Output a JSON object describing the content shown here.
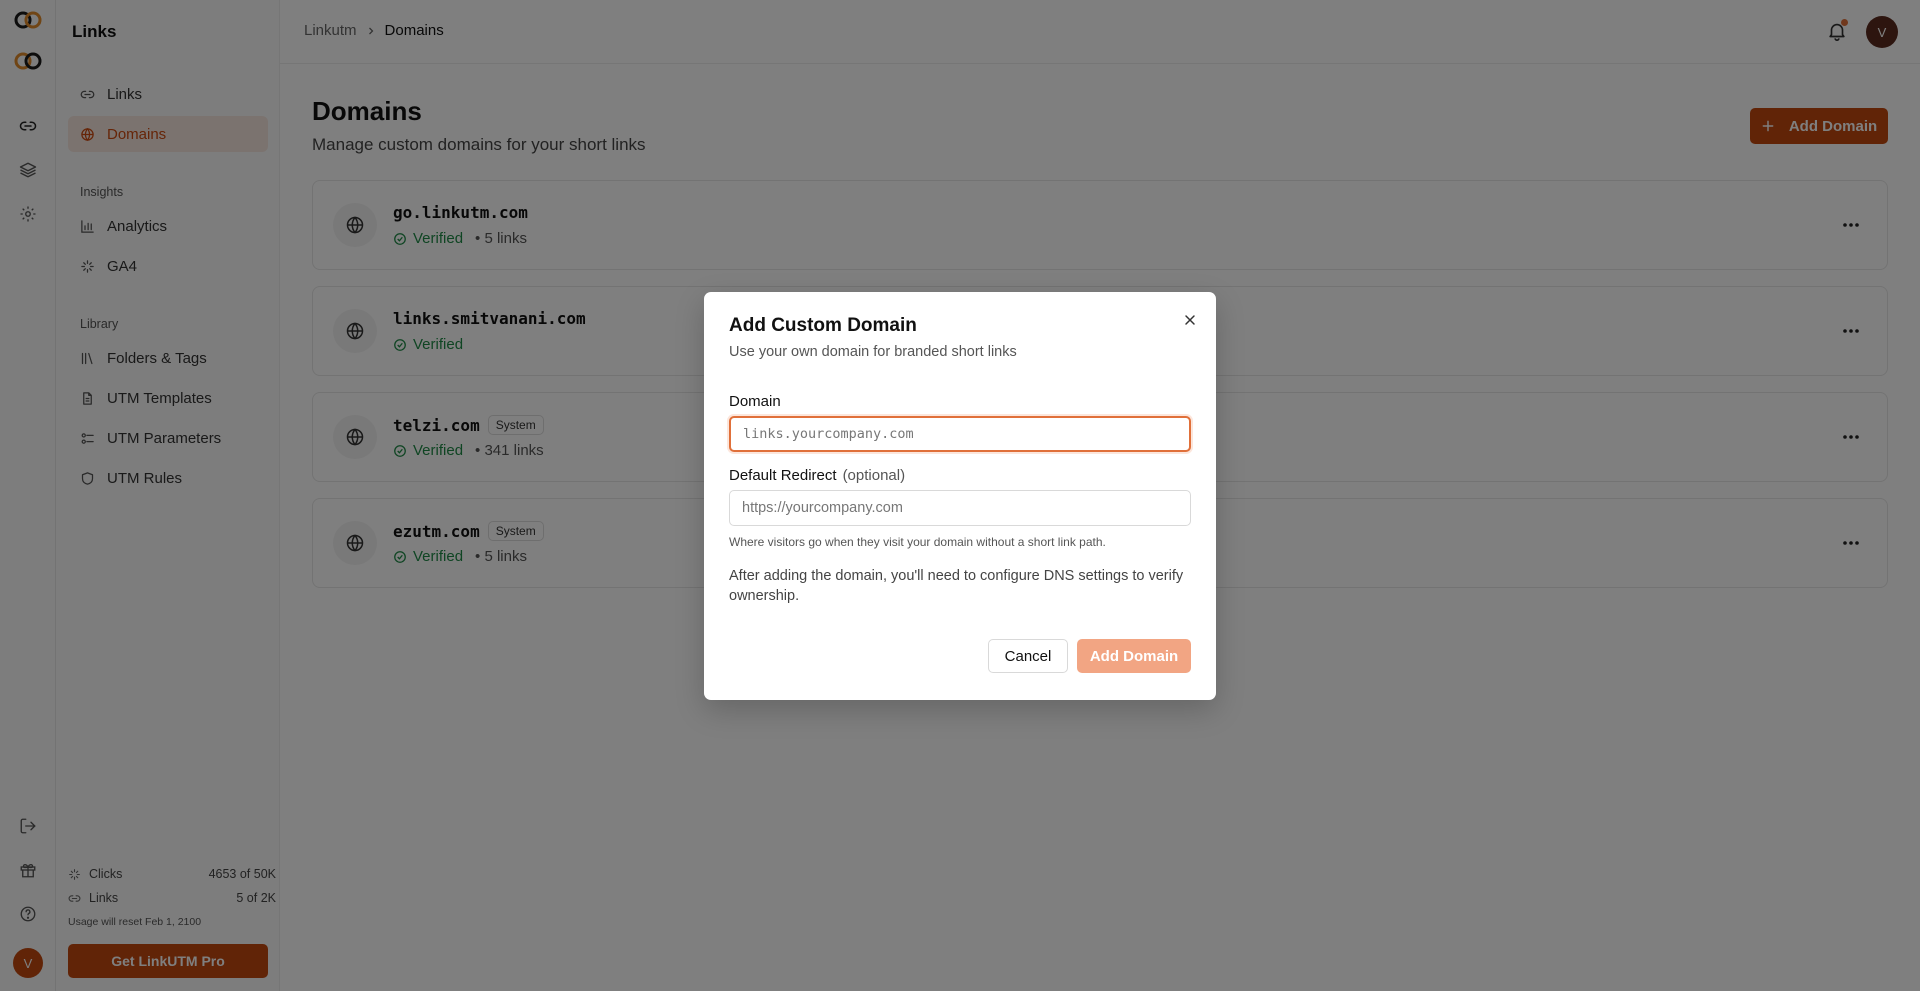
{
  "sidebar": {
    "title": "Links",
    "nav": [
      {
        "label": "Links",
        "icon": "link-icon",
        "active": false
      },
      {
        "label": "Domains",
        "icon": "globe-icon",
        "active": true
      }
    ],
    "insights_label": "Insights",
    "insights": [
      {
        "label": "Analytics",
        "icon": "bar-chart-icon"
      },
      {
        "label": "GA4",
        "icon": "sparkle-icon"
      }
    ],
    "library_label": "Library",
    "library": [
      {
        "label": "Folders & Tags",
        "icon": "library-icon"
      },
      {
        "label": "UTM Templates",
        "icon": "document-icon"
      },
      {
        "label": "UTM Parameters",
        "icon": "parameters-icon"
      },
      {
        "label": "UTM Rules",
        "icon": "shield-icon"
      }
    ],
    "usage": {
      "clicks_label": "Clicks",
      "clicks_value": "4653 of 50K",
      "links_label": "Links",
      "links_value": "5 of 2K",
      "reset_note": "Usage will reset Feb 1, 2100"
    },
    "pro_button": "Get LinkUTM Pro"
  },
  "rail": {
    "avatar_initial": "V"
  },
  "topbar": {
    "breadcrumb_root": "Linkutm",
    "breadcrumb_current": "Domains",
    "avatar_initial": "V"
  },
  "main": {
    "title": "Domains",
    "subtitle": "Manage custom domains for your short links",
    "add_button": "Add Domain",
    "domains": [
      {
        "name": "go.linkutm.com",
        "status": "Verified",
        "links": "• 5 links",
        "badge": ""
      },
      {
        "name": "links.smitvanani.com",
        "status": "Verified",
        "links": "",
        "badge": ""
      },
      {
        "name": "telzi.com",
        "status": "Verified",
        "links": "• 341 links",
        "badge": "System"
      },
      {
        "name": "ezutm.com",
        "status": "Verified",
        "links": "• 5 links",
        "badge": "System"
      }
    ]
  },
  "modal": {
    "title": "Add Custom Domain",
    "subtitle": "Use your own domain for branded short links",
    "domain_label": "Domain",
    "domain_placeholder": "links.yourcompany.com",
    "redirect_label": "Default Redirect",
    "redirect_optional": "(optional)",
    "redirect_placeholder": "https://yourcompany.com",
    "redirect_help": "Where visitors go when they visit your domain without a short link path.",
    "dns_note": "After adding the domain, you'll need to configure DNS settings to verify ownership.",
    "cancel": "Cancel",
    "submit": "Add Domain"
  },
  "colors": {
    "accent": "#c2480f",
    "accent_disabled": "#f2a583",
    "verified": "#1f8a46"
  }
}
